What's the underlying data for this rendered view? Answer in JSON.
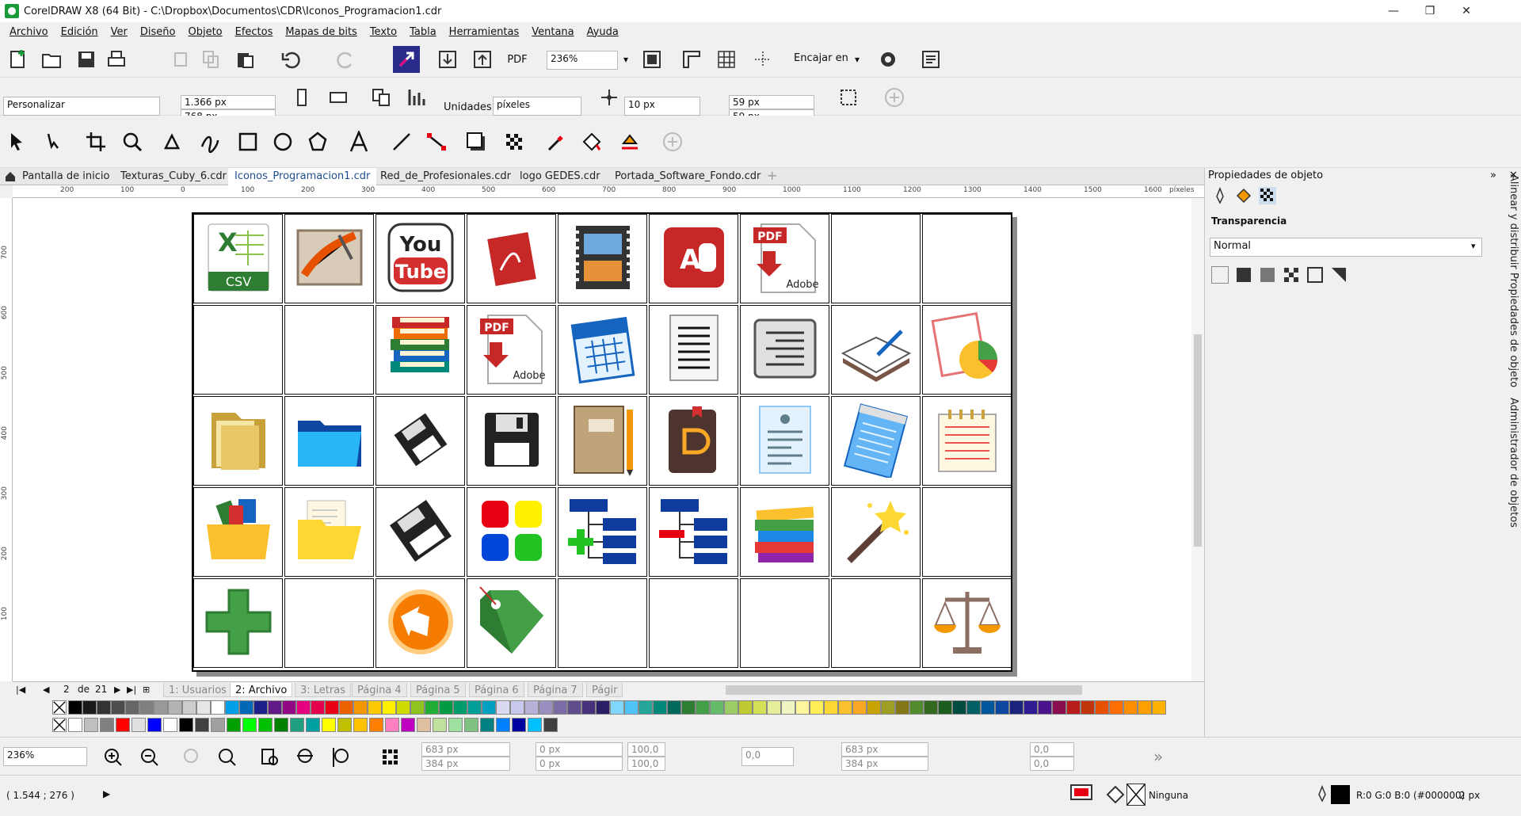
{
  "title_bar": {
    "text": "CorelDRAW X8 (64 Bit) - C:\\Dropbox\\Documentos\\CDR\\Iconos_Programacion1.cdr"
  },
  "menu": [
    "Archivo",
    "Edición",
    "Ver",
    "Diseño",
    "Objeto",
    "Efectos",
    "Mapas de bits",
    "Texto",
    "Tabla",
    "Herramientas",
    "Ventana",
    "Ayuda"
  ],
  "standard_toolbar": {
    "zoom_value": "236%",
    "snap_label": "Encajar en",
    "pdf_label": "PDF"
  },
  "property_bar": {
    "page_preset": "Personalizar",
    "width": "1.366 px",
    "height": "768 px",
    "units_label": "Unidades:",
    "units_value": "píxeles",
    "nudge": "10 px",
    "dup_x": "59 px",
    "dup_y": "59 px"
  },
  "doc_tabs": [
    {
      "label": "Pantalla de inicio"
    },
    {
      "label": "Texturas_Cuby_6.cdr"
    },
    {
      "label": "Iconos_Programacion1.cdr"
    },
    {
      "label": "Red_de_Profesionales.cdr"
    },
    {
      "label": "logo GEDES.cdr"
    },
    {
      "label": "Portada_Software_Fondo.cdr"
    }
  ],
  "ruler_h": [
    "200",
    "100",
    "0",
    "100",
    "200",
    "300",
    "400",
    "500",
    "600",
    "700",
    "800",
    "900",
    "1000",
    "1100",
    "1200",
    "1300",
    "1400",
    "1500",
    "1600",
    "píxeles"
  ],
  "ruler_v": [
    "700",
    "600",
    "500",
    "400",
    "300",
    "200",
    "100"
  ],
  "page_nav": {
    "current": "2",
    "of_label": "de",
    "total": "21"
  },
  "page_tabs": [
    "1: Usuarios",
    "2: Archivo",
    "3: Letras",
    "Página 4",
    "Página 5",
    "Página 6",
    "Página 7",
    "Págir"
  ],
  "icon_grid": [
    [
      "csv-icon",
      "paint-image-icon",
      "youtube-icon",
      "acrobat-icon",
      "film-icon",
      "access-icon",
      "pdf-adobe-icon",
      "",
      ""
    ],
    [
      "",
      "",
      "books-icon",
      "pdf-adobe-icon",
      "calendar-icon",
      "document-lines-icon",
      "text-align-icon",
      "book-pen-icon",
      "report-chart-icon"
    ],
    [
      "folder-open-icon",
      "folder-blue-icon",
      "floppy-small-icon",
      "floppy-icon",
      "notebook-pencil-icon",
      "ebook-icon",
      "form-document-icon",
      "notepad-icon",
      "lined-notepad-icon"
    ],
    [
      "folder-colors-icon",
      "folder-yellow-icon",
      "floppy-tilted-icon",
      "color-squares-icon",
      "tree-add-icon",
      "tree-remove-icon",
      "books-stack-icon",
      "magic-wand-icon",
      ""
    ],
    [
      "plus-icon",
      "",
      "orange-arrow-icon",
      "green-tag-icon",
      "",
      "",
      "",
      "",
      "scales-icon"
    ]
  ],
  "object_properties": {
    "panel_title": "Propiedades de objeto",
    "section": "Transparencia",
    "mode": "Normal",
    "side_tabs": [
      "Alinear y distribuir",
      "Propiedades de objeto",
      "Administrador de objetos"
    ]
  },
  "bottom_bar": {
    "zoom": "236%",
    "x": "683 px",
    "y": "384 px",
    "w": "0 px",
    "h": "0 px",
    "sx": "100,0",
    "sy": "100,0",
    "angle": "0,0",
    "cx": "683 px",
    "cy": "384 px",
    "skew_h": "0,0",
    "skew_v": "0,0"
  },
  "status_bar": {
    "coords": "( 1.544 ; 276 )",
    "fill_label": "Ninguna",
    "outline_label": "R:0 G:0 B:0 (#000000)",
    "outline_width": "2 px"
  },
  "palette_top": [
    "#000000",
    "#1a1a1a",
    "#333333",
    "#4d4d4d",
    "#666666",
    "#808080",
    "#999999",
    "#b3b3b3",
    "#cccccc",
    "#e6e6e6",
    "#ffffff",
    "#00a0e9",
    "#0068b7",
    "#1d2088",
    "#601986",
    "#920783",
    "#e4007f",
    "#e5004f",
    "#e60012",
    "#eb6100",
    "#f39800",
    "#fcc800",
    "#fff100",
    "#cfdb00",
    "#8fc31f",
    "#22ac38",
    "#009944",
    "#009b6b",
    "#009e96",
    "#00a0c1",
    "#d9d9f2",
    "#c9c9ef",
    "#b8b0d8",
    "#9b8fbf",
    "#7b6ca6",
    "#604d8c",
    "#46327a",
    "#2b1d66",
    "#80d8ff",
    "#4fc3f7",
    "#26a69a",
    "#00897b",
    "#00695c",
    "#2e7d32",
    "#43a047",
    "#66bb6a",
    "#9ccc65",
    "#c0ca33",
    "#d4e157",
    "#e6ee9c",
    "#f0f4c3",
    "#fff59d",
    "#ffee58",
    "#fdd835",
    "#fbc02d",
    "#f9a825",
    "#c6a300",
    "#9e9d24",
    "#827717",
    "#558b2f",
    "#33691e",
    "#1b5e20",
    "#004d40",
    "#006064",
    "#01579b",
    "#0d47a1",
    "#1a237e",
    "#311b92",
    "#4a148c",
    "#880e4f",
    "#b71c1c",
    "#bf360c",
    "#e65100",
    "#ff6f00",
    "#ff8f00",
    "#ffa000",
    "#ffb300",
    "#ffc107"
  ],
  "palette_bottom": [
    "#ffffff",
    "#bfbfbf",
    "#808080",
    "#ff0000",
    "#e0e0e0",
    "#0000ff",
    "#ffffff",
    "#000000",
    "#404040",
    "#a0a0a0",
    "#00a000",
    "#00ff00",
    "#00c000",
    "#008000",
    "#20a080",
    "#00a0a0",
    "#ffff00",
    "#c0c000",
    "#ffc000",
    "#ff8000",
    "#ff80c0",
    "#c000c0",
    "#e0c0a0",
    "#c0e0a0",
    "#a0e0a0",
    "#80c080",
    "#008080",
    "#0080ff",
    "#0000a0",
    "#00c0ff",
    "#404040"
  ]
}
